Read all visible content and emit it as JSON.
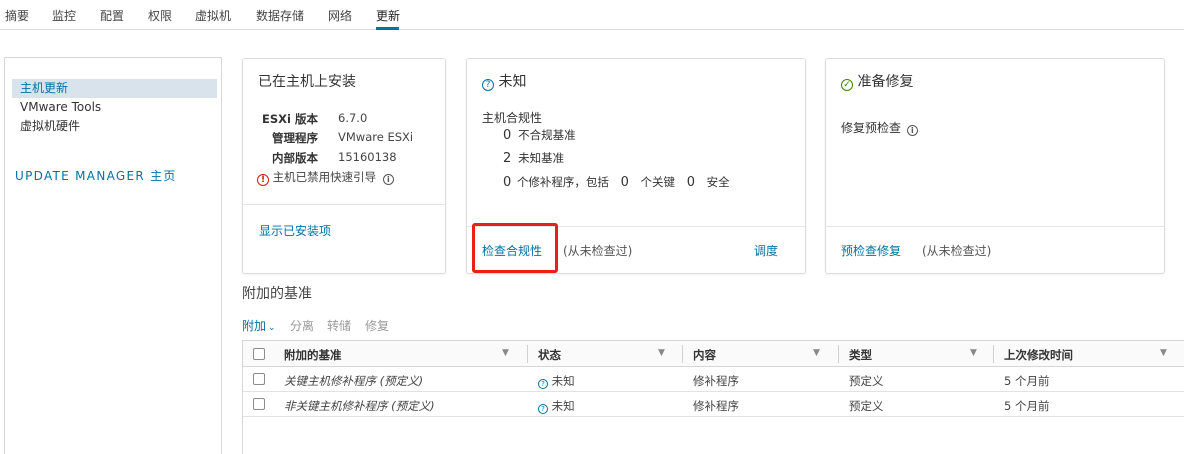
{
  "tabs": [
    {
      "label": "摘要"
    },
    {
      "label": "监控"
    },
    {
      "label": "配置"
    },
    {
      "label": "权限"
    },
    {
      "label": "虚拟机"
    },
    {
      "label": "数据存储"
    },
    {
      "label": "网络"
    },
    {
      "label": "更新"
    }
  ],
  "active_tab": "更新",
  "sidebar": {
    "items": [
      {
        "label": "主机更新"
      },
      {
        "label": "VMware Tools"
      },
      {
        "label": "虚拟机硬件"
      }
    ],
    "update_manager_link": "UPDATE MANAGER 主页"
  },
  "installed_card": {
    "title": "已在主机上安装",
    "rows": [
      {
        "label": "ESXi 版本",
        "value": "6.7.0"
      },
      {
        "label": "管理程序",
        "value": "VMware ESXi"
      },
      {
        "label": "内部版本",
        "value": "15160138"
      }
    ],
    "warning": "主机已禁用快速引导",
    "show_installed_link": "显示已安装项"
  },
  "compliance_card": {
    "title": "未知",
    "subtitle": "主机合规性",
    "noncompliant_count": "0",
    "noncompliant_label": "不合规基准",
    "unknown_count": "2",
    "unknown_label": "未知基准",
    "patch_count": "0",
    "patch_text": "个修补程序，包括",
    "critical_count": "0",
    "critical_label": "个关键",
    "security_count": "0",
    "security_label": "安全",
    "check_link": "检查合规性",
    "check_status": "(从未检查过)",
    "schedule_link": "调度"
  },
  "remediation_card": {
    "title": "准备修复",
    "precheck_label": "修复预检查",
    "precheck_link": "预检查修复",
    "precheck_status": "(从未检查过)"
  },
  "baselines": {
    "section_title": "附加的基准",
    "toolbar": {
      "attach": "附加",
      "detach": "分离",
      "stage": "转储",
      "remediate": "修复"
    },
    "columns": [
      "附加的基准",
      "状态",
      "内容",
      "类型",
      "上次修改时间"
    ],
    "rows": [
      {
        "name": "关键主机修补程序 (预定义)",
        "status": "未知",
        "content": "修补程序",
        "type": "预定义",
        "modified": "5 个月前"
      },
      {
        "name": "非关键主机修补程序 (预定义)",
        "status": "未知",
        "content": "修补程序",
        "type": "预定义",
        "modified": "5 个月前"
      }
    ]
  },
  "colors": {
    "link": "#0072a3",
    "highlight": "#e8201a",
    "ok": "#3c8500",
    "warning": "#c92100"
  }
}
